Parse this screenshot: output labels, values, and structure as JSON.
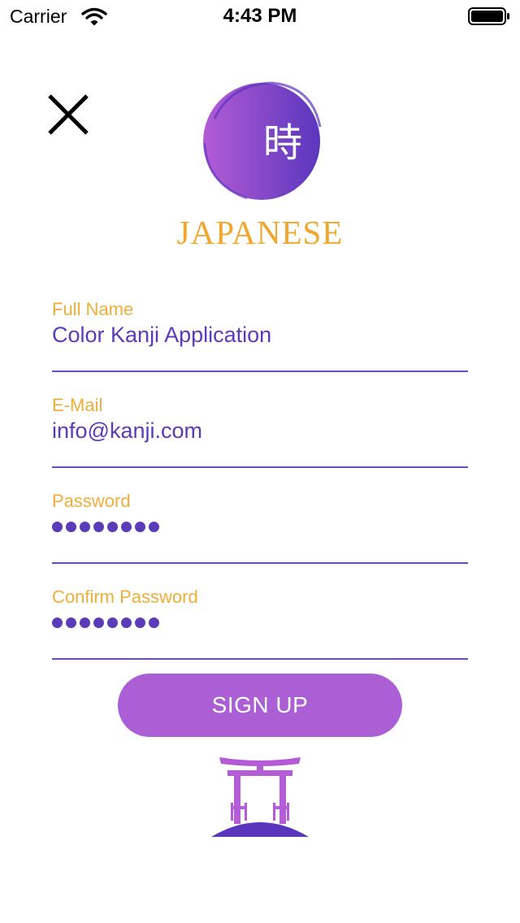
{
  "status_bar": {
    "carrier": "Carrier",
    "time": "4:43 PM",
    "icons": [
      "wifi-icon",
      "battery-icon"
    ]
  },
  "header": {
    "close_icon": "close-icon",
    "logo_kanji": "時",
    "logo_title": "JAPANESE"
  },
  "form": {
    "full_name": {
      "label": "Full Name",
      "value": "Color Kanji Application"
    },
    "email": {
      "label": "E-Mail",
      "value": "info@kanji.com"
    },
    "password": {
      "label": "Password",
      "masked_length": 8
    },
    "confirm_password": {
      "label": "Confirm Password",
      "masked_length": 8
    }
  },
  "signup_button": {
    "label": "SIGN UP"
  },
  "footer": {
    "icon": "torii-gate-icon"
  },
  "colors": {
    "accent_purple": "#5B3BB8",
    "button_purple": "#AC5ED4",
    "label_orange": "#EFAE3A",
    "logo_gradient_start": "#B45CD6",
    "logo_gradient_end": "#5A36BD"
  }
}
